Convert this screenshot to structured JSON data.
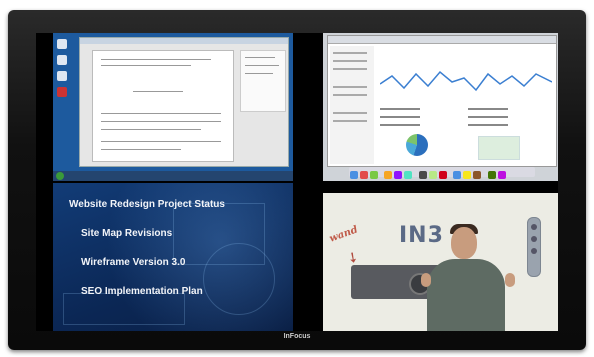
{
  "brand": {
    "label": "InFocus"
  },
  "slide": {
    "title": "Website Redesign Project Status",
    "bullets": [
      "Site Map Revisions",
      "Wireframe Version 3.0",
      "SEO Implementation Plan"
    ]
  },
  "video": {
    "board_text": "IN3 D",
    "annotation": "wand"
  },
  "colors": {
    "bezel": "#1a1a1a",
    "slide_bg": "#0c2f63",
    "slide_text": "#f2f4f8",
    "board_text": "#5b6a86",
    "annotation": "#c05a48"
  },
  "icons": [
    "desktop-icon",
    "start-orb-icon",
    "pie-chart-icon",
    "arrow-icon",
    "projector-icon",
    "remote-icon"
  ]
}
